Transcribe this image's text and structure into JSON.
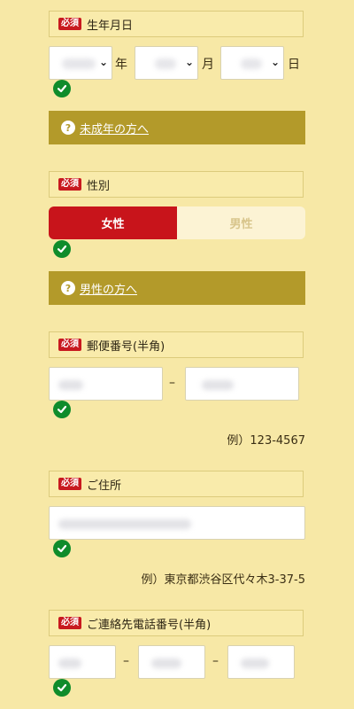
{
  "required_badge": "必須",
  "birthdate": {
    "label": "生年月日",
    "year_unit": "年",
    "month_unit": "月",
    "day_unit": "日"
  },
  "minor_link": "未成年の方へ",
  "gender": {
    "label": "性別",
    "female": "女性",
    "male": "男性",
    "selected": "女性"
  },
  "male_link": "男性の方へ",
  "postal": {
    "label": "郵便番号(半角)",
    "separator": "–",
    "example": "例）123-4567"
  },
  "address": {
    "label": "ご住所",
    "example": "例）東京都渋谷区代々木3-37-5"
  },
  "phone": {
    "label": "ご連絡先電話番号(半角)",
    "separator": "–"
  },
  "colors": {
    "background": "#f7e8a6",
    "accent_gold": "#b39a2a",
    "required_red": "#c8191f",
    "check_green": "#0f8c2b"
  },
  "icons": [
    "checkmark-icon",
    "question-icon",
    "chevron-down-icon"
  ]
}
